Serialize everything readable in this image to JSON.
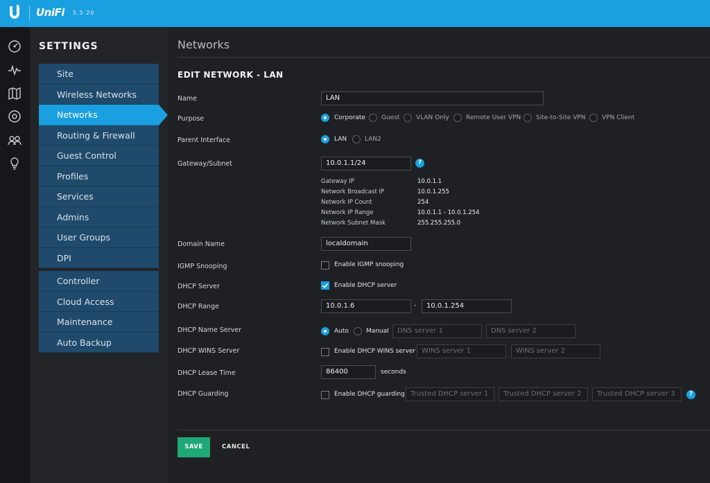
{
  "app": {
    "brand": "UniFi",
    "version": "5.5.20"
  },
  "settings": {
    "title": "SETTINGS",
    "menu_group1": [
      "Site",
      "Wireless Networks",
      "Networks",
      "Routing & Firewall",
      "Guest Control",
      "Profiles",
      "Services",
      "Admins",
      "User Groups",
      "DPI"
    ],
    "menu_group2": [
      "Controller",
      "Cloud Access",
      "Maintenance",
      "Auto Backup"
    ],
    "active_item": "Networks"
  },
  "main": {
    "title": "Networks",
    "section": "EDIT NETWORK - LAN"
  },
  "form": {
    "name": {
      "label": "Name",
      "value": "LAN"
    },
    "purpose": {
      "label": "Purpose",
      "options": [
        "Corporate",
        "Guest",
        "VLAN Only",
        "Remote User VPN",
        "Site-to-Site VPN",
        "VPN Client"
      ],
      "selected": "Corporate"
    },
    "parent_interface": {
      "label": "Parent Interface",
      "options": [
        "LAN",
        "LAN2"
      ],
      "selected": "LAN"
    },
    "gateway": {
      "label": "Gateway/Subnet",
      "value": "10.0.1.1/24",
      "help": "?"
    },
    "gateway_info": {
      "labels": [
        "Gateway IP",
        "Network Broadcast IP",
        "Network IP Count",
        "Network IP Range",
        "Network Subnet Mask"
      ],
      "values": [
        "10.0.1.1",
        "10.0.1.255",
        "254",
        "10.0.1.1 - 10.0.1.254",
        "255.255.255.0"
      ]
    },
    "domain_name": {
      "label": "Domain Name",
      "value": "localdomain"
    },
    "igmp": {
      "label": "IGMP Snooping",
      "option": "Enable IGMP snooping",
      "checked": false
    },
    "dhcp_server": {
      "label": "DHCP Server",
      "option": "Enable DHCP server",
      "checked": true
    },
    "dhcp_range": {
      "label": "DHCP Range",
      "start": "10.0.1.6",
      "separator": "-",
      "end": "10.0.1.254"
    },
    "dhcp_name_server": {
      "label": "DHCP Name Server",
      "options": [
        "Auto",
        "Manual"
      ],
      "selected": "Auto",
      "placeholder1": "DNS server 1",
      "placeholder2": "DNS server 2"
    },
    "dhcp_wins": {
      "label": "DHCP WINS Server",
      "option": "Enable DHCP WINS server",
      "checked": false,
      "placeholder1": "WINS server 1",
      "placeholder2": "WINS server 2"
    },
    "lease_time": {
      "label": "DHCP Lease Time",
      "value": "86400",
      "unit": "seconds"
    },
    "guarding": {
      "label": "DHCP Guarding",
      "option": "Enable DHCP guarding",
      "checked": false,
      "placeholder1": "Trusted DHCP server 1",
      "placeholder2": "Trusted DHCP server 2",
      "placeholder3": "Trusted DHCP server 3",
      "help": "?"
    }
  },
  "actions": {
    "save": "SAVE",
    "cancel": "CANCEL"
  },
  "colors": {
    "accent": "#1a9fe0",
    "save": "#1fa878",
    "background": "#1e2023"
  },
  "icons": [
    "ubiquiti-logo",
    "dashboard-icon",
    "statistics-icon",
    "map-icon",
    "devices-icon",
    "clients-icon",
    "insights-icon"
  ]
}
